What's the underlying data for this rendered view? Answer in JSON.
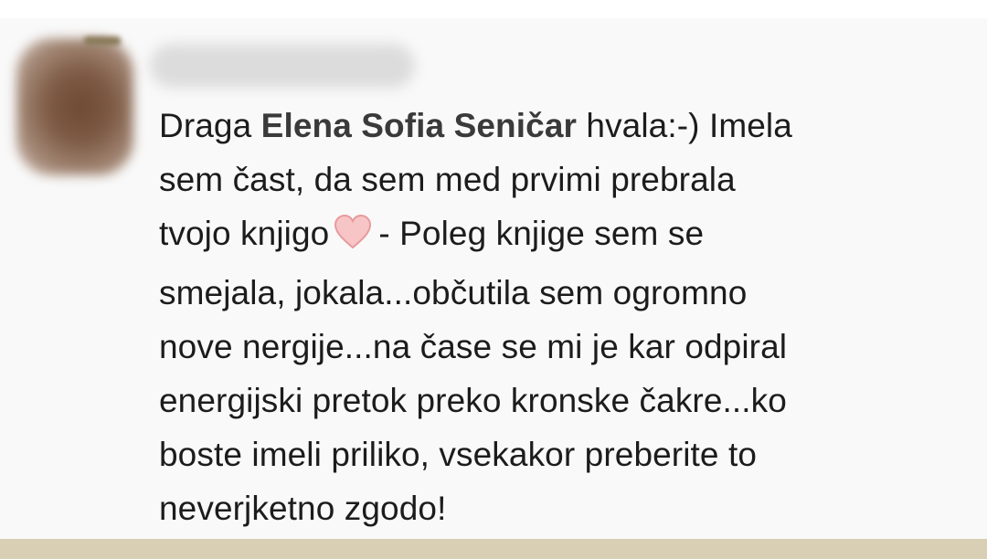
{
  "comment": {
    "greeting": "Draga",
    "tagged_name": "Elena Sofia Seničar",
    "line1_rest": "hvala:-) Imela",
    "line2": "sem čast, da sem med prvimi prebrala",
    "line3_before_icon": "tvojo knjigo",
    "line3_after_icon": "-  Poleg knjige sem se",
    "line4": "smejala, jokala...občutila sem ogromno",
    "line5": "nove nergije...na  čase se mi je kar odpiral",
    "line6": "energijski pretok preko kronske čakre...ko",
    "line7": "boste imeli priliko, vsekakor preberite to",
    "line8": "neverjketno zgodo!",
    "icon": "heart-icon",
    "heart_color": "#f4b6b8"
  },
  "colors": {
    "text": "#1c1c1c",
    "bottom_bar": "#d8cfb4"
  }
}
